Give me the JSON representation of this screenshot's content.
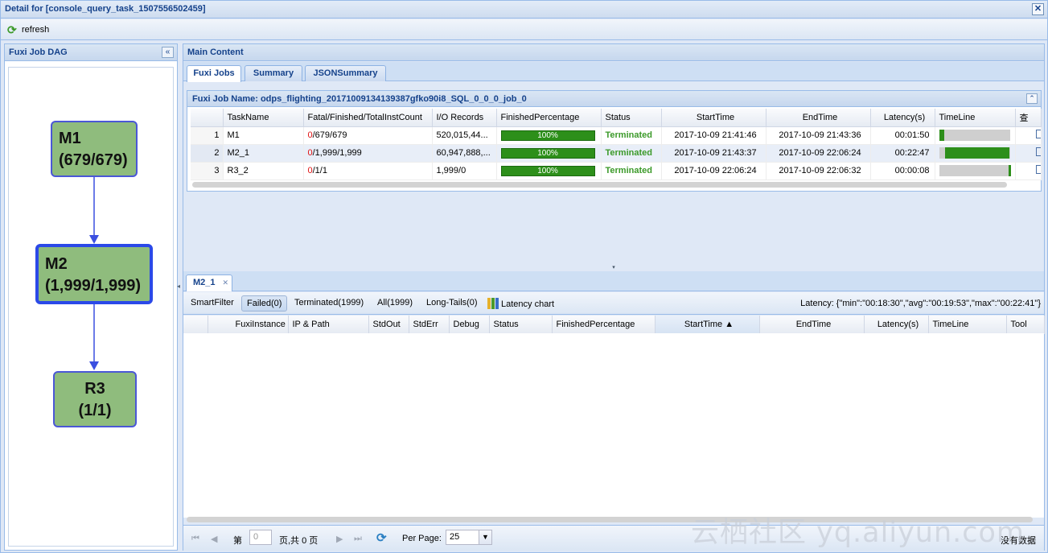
{
  "window": {
    "title": "Detail for [console_query_task_1507556502459]",
    "close": "✕"
  },
  "toolbar": {
    "refresh_label": "refresh"
  },
  "left_panel": {
    "title": "Fuxi Job DAG",
    "nodes": [
      {
        "name": "M1",
        "count": "(679/679)"
      },
      {
        "name": "M2",
        "count": "(1,999/1,999)"
      },
      {
        "name": "R3",
        "count": "(1/1)"
      }
    ]
  },
  "main": {
    "title": "Main Content",
    "tabs": [
      "Fuxi Jobs",
      "Summary",
      "JSONSummary"
    ],
    "job_name": "Fuxi Job Name: odps_flighting_20171009134139387gfko90i8_SQL_0_0_0_job_0",
    "task_columns": [
      "",
      "TaskName",
      "Fatal/Finished/TotalInstCount",
      "I/O Records",
      "FinishedPercentage",
      "Status",
      "StartTime",
      "EndTime",
      "Latency(s)",
      "TimeLine",
      "查"
    ],
    "tasks": [
      {
        "rownum": "1",
        "name": "M1",
        "fatal": "0",
        "counts": "/679/679",
        "io": "520,015,44...",
        "percent": "100%",
        "pct": 1.0,
        "status": "Terminated",
        "start": "2017-10-09 21:41:46",
        "end": "2017-10-09 21:43:36",
        "latency": "00:01:50",
        "tl_start": 0.0,
        "tl_len": 0.07
      },
      {
        "rownum": "2",
        "name": "M2_1",
        "fatal": "0",
        "counts": "/1,999/1,999",
        "io": "60,947,888,...",
        "percent": "100%",
        "pct": 1.0,
        "status": "Terminated",
        "start": "2017-10-09 21:43:37",
        "end": "2017-10-09 22:06:24",
        "latency": "00:22:47",
        "tl_start": 0.08,
        "tl_len": 0.92
      },
      {
        "rownum": "3",
        "name": "R3_2",
        "fatal": "0",
        "counts": "/1/1",
        "io": "1,999/0",
        "percent": "100%",
        "pct": 1.0,
        "status": "Terminated",
        "start": "2017-10-09 22:06:24",
        "end": "2017-10-09 22:06:32",
        "latency": "00:00:08",
        "tl_start": 0.98,
        "tl_len": 0.02
      }
    ]
  },
  "instance_panel": {
    "tab": "M2_1",
    "filters": [
      "SmartFilter",
      "Failed(0)",
      "Terminated(1999)",
      "All(1999)",
      "Long-Tails(0)",
      "Latency chart"
    ],
    "latency": "Latency: {\"min\":\"00:18:30\",\"avg\":\"00:19:53\",\"max\":\"00:22:41\"}",
    "columns": [
      "",
      "FuxiInstance",
      "IP & Path",
      "StdOut",
      "StdErr",
      "Debug",
      "Status",
      "FinishedPercentage",
      "StartTime ▲",
      "EndTime",
      "Latency(s)",
      "TimeLine",
      "Tool"
    ]
  },
  "pager": {
    "page_label": "第",
    "page_value": "0",
    "of_label": "页,共 0 页",
    "per_page_label": "Per Page:",
    "per_page_value": "25",
    "empty": "没有数据"
  },
  "watermark": "云栖社区 yq.aliyun.com",
  "colors": {
    "accent": "#15428b",
    "progress": "#2d8f1a",
    "node_fill": "#8fbc7d",
    "node_border": "#2b49e8"
  }
}
